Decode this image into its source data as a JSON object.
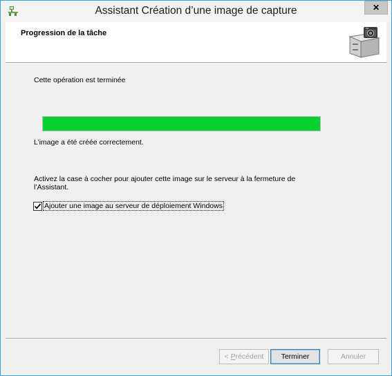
{
  "window": {
    "title": "Assistant Création d’une image de capture",
    "close_glyph": "✕"
  },
  "header": {
    "title": "Progression de la tâche",
    "icon": "file-cabinet-camera-icon"
  },
  "content": {
    "status": "Cette opération est terminée",
    "progress_fraction": 1.0,
    "progress_color": "#06d130",
    "result": "L’image a été créée correctement.",
    "instruction_line1": "Activez la case à cocher pour ajouter cette image sur le serveur à la fermeture de",
    "instruction_line2": "l’Assistant.",
    "checkbox_label": "Ajouter une image au serveur de déploiement Windows",
    "checkbox_checked": true
  },
  "buttons": {
    "prev_prefix": "< ",
    "prev_mnemonic": "P",
    "prev_rest": "récédent",
    "finish": "Terminer",
    "cancel": "Annuler"
  },
  "colors": {
    "window_border": "#3aa0e2"
  }
}
